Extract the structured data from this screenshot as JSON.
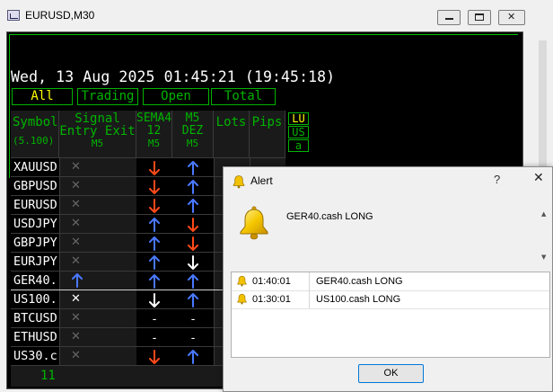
{
  "window": {
    "title": "EURUSD,M30"
  },
  "panel": {
    "datetime": "Wed, 13 Aug 2025 01:45:21 (19:45:18)",
    "tabs": [
      {
        "label": "All",
        "active": true
      },
      {
        "label": "Trading",
        "active": false
      },
      {
        "label": "Open",
        "active": false
      },
      {
        "label": "Total",
        "active": false
      }
    ],
    "headers": {
      "symbol": "Symbol",
      "symbol_sub": "(5.100)",
      "signal_l1": "Signal",
      "signal_l2": "Entry Exit",
      "signal_l3": "M5",
      "sema_l1": "SEMA4",
      "sema_l2": "12",
      "sema_l3": "M5",
      "m5_l1": "M5",
      "m5_l2": "DEZ",
      "m5_l3": "M5",
      "lots": "Lots",
      "pips": "Pips"
    },
    "side_labels": [
      "LU",
      "US",
      "a"
    ],
    "rows": [
      {
        "symbol": "XAUUSD",
        "signal": "x",
        "sema": "down",
        "m5": "up"
      },
      {
        "symbol": "GBPUSD",
        "signal": "x",
        "sema": "down",
        "m5": "up"
      },
      {
        "symbol": "EURUSD",
        "signal": "x",
        "sema": "down",
        "m5": "up"
      },
      {
        "symbol": "USDJPY",
        "signal": "x",
        "sema": "up",
        "m5": "down"
      },
      {
        "symbol": "GBPJPY",
        "signal": "x",
        "sema": "up",
        "m5": "down"
      },
      {
        "symbol": "EURJPY",
        "signal": "x",
        "sema": "up",
        "m5": "down-white"
      },
      {
        "symbol": "GER40.",
        "signal": "up",
        "sema": "up",
        "m5": "up"
      },
      {
        "symbol": "US100.",
        "signal": "x-white",
        "sema": "down-white",
        "m5": "up",
        "selected": true
      },
      {
        "symbol": "BTCUSD",
        "signal": "x",
        "sema": "dash",
        "m5": "dash"
      },
      {
        "symbol": "ETHUSD",
        "signal": "x",
        "sema": "dash",
        "m5": "dash"
      },
      {
        "symbol": "US30.c",
        "signal": "x",
        "sema": "down",
        "m5": "up"
      }
    ],
    "footer_count": "11"
  },
  "colors": {
    "green": "#00b400",
    "yellow": "#ffff00",
    "arrow_up": "#4a78ff",
    "arrow_down": "#ff4a1a",
    "white": "#ffffff"
  },
  "alert": {
    "title": "Alert",
    "help": "?",
    "close": "✕",
    "message": "GER40.cash LONG",
    "log": [
      {
        "time": "01:40:01",
        "message": "GER40.cash LONG"
      },
      {
        "time": "01:30:01",
        "message": "US100.cash LONG"
      }
    ],
    "ok_label": "OK"
  },
  "icons": {
    "app": "chart-window-icon",
    "alert": "bell-icon"
  }
}
